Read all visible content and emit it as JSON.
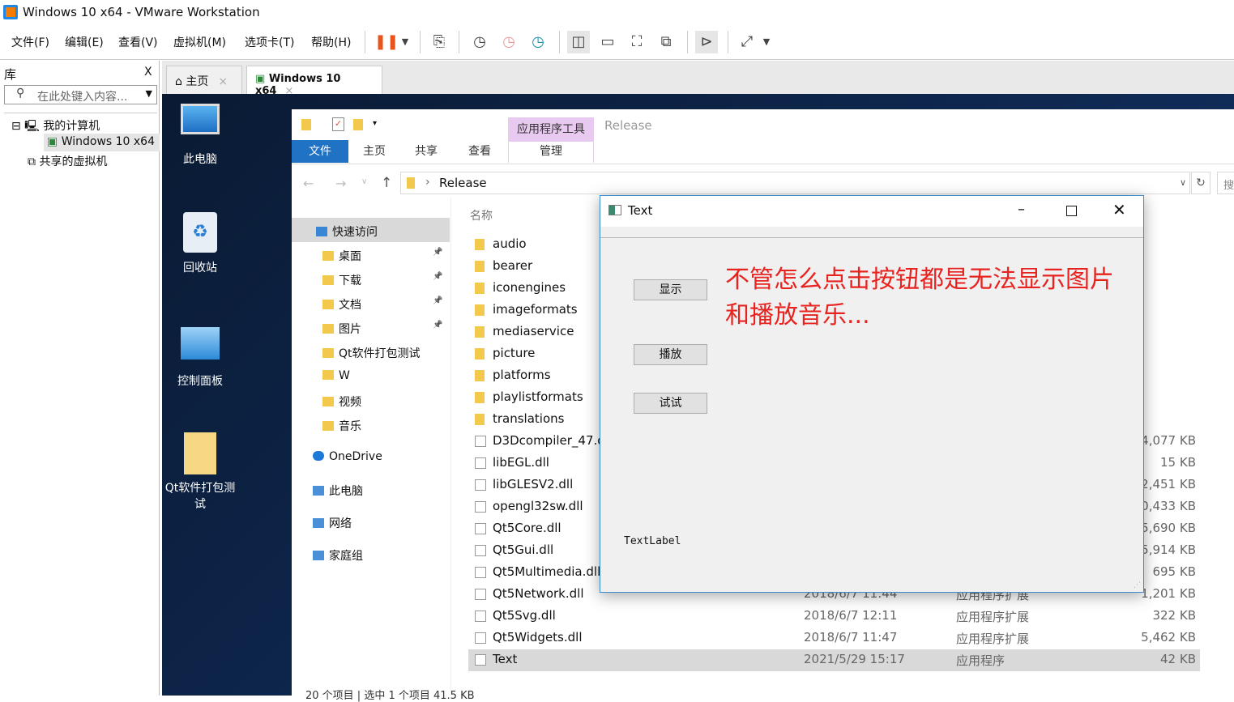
{
  "window": {
    "title": "Windows 10 x64 - VMware Workstation"
  },
  "menu": [
    "文件(F)",
    "编辑(E)",
    "查看(V)",
    "虚拟机(M)",
    "选项卡(T)",
    "帮助(H)"
  ],
  "library": {
    "title": "库",
    "close": "X",
    "search_placeholder": "在此处键入内容...",
    "tree": [
      "我的计算机",
      "Windows 10 x64",
      "共享的虚拟机"
    ]
  },
  "tabs": [
    {
      "label": "主页",
      "close": "×"
    },
    {
      "label": "Windows 10 x64",
      "close": "×"
    }
  ],
  "desktop": [
    "此电脑",
    "回收站",
    "控制面板",
    "Qt软件打包测试"
  ],
  "explorer": {
    "context_tab": "应用程序工具",
    "title": "Release",
    "ribbon_tabs": [
      "文件",
      "主页",
      "共享",
      "查看",
      "管理"
    ],
    "path": "Release",
    "search": "搜",
    "column_name": "名称",
    "nav": [
      "快速访问",
      "桌面",
      "下载",
      "文档",
      "图片",
      "Qt软件打包测试",
      "W",
      "视频",
      "音乐",
      "OneDrive",
      "此电脑",
      "网络",
      "家庭组"
    ],
    "files": [
      {
        "name": "audio",
        "folder": true
      },
      {
        "name": "bearer",
        "folder": true
      },
      {
        "name": "iconengines",
        "folder": true
      },
      {
        "name": "imageformats",
        "folder": true
      },
      {
        "name": "mediaservice",
        "folder": true
      },
      {
        "name": "picture",
        "folder": true
      },
      {
        "name": "platforms",
        "folder": true
      },
      {
        "name": "playlistformats",
        "folder": true
      },
      {
        "name": "translations",
        "folder": true
      },
      {
        "name": "D3Dcompiler_47.d",
        "size": "4,077 KB"
      },
      {
        "name": "libEGL.dll",
        "size": "15 KB"
      },
      {
        "name": "libGLESV2.dll",
        "size": "2,451 KB"
      },
      {
        "name": "opengl32sw.dll",
        "size": "0,433 KB"
      },
      {
        "name": "Qt5Core.dll",
        "size": "5,690 KB"
      },
      {
        "name": "Qt5Gui.dll",
        "size": "5,914 KB"
      },
      {
        "name": "Qt5Multimedia.dll",
        "size": "695 KB"
      },
      {
        "name": "Qt5Network.dll",
        "date": "2018/6/7 11:44",
        "type": "应用程序扩展",
        "size": "1,201 KB"
      },
      {
        "name": "Qt5Svg.dll",
        "date": "2018/6/7 12:11",
        "type": "应用程序扩展",
        "size": "322 KB"
      },
      {
        "name": "Qt5Widgets.dll",
        "date": "2018/6/7 11:47",
        "type": "应用程序扩展",
        "size": "5,462 KB"
      },
      {
        "name": "Text",
        "date": "2021/5/29 15:17",
        "type": "应用程序",
        "size": "42 KB",
        "selected": true
      }
    ],
    "status": "20 个项目  |  选中 1 个项目  41.5 KB"
  },
  "qt_window": {
    "title": "Text",
    "buttons": [
      "显示",
      "播放",
      "试试"
    ],
    "annotation": "不管怎么点击按钮都是无法显示图片和播放音乐...",
    "label": "TextLabel",
    "annotation_color": "#e8231f"
  }
}
